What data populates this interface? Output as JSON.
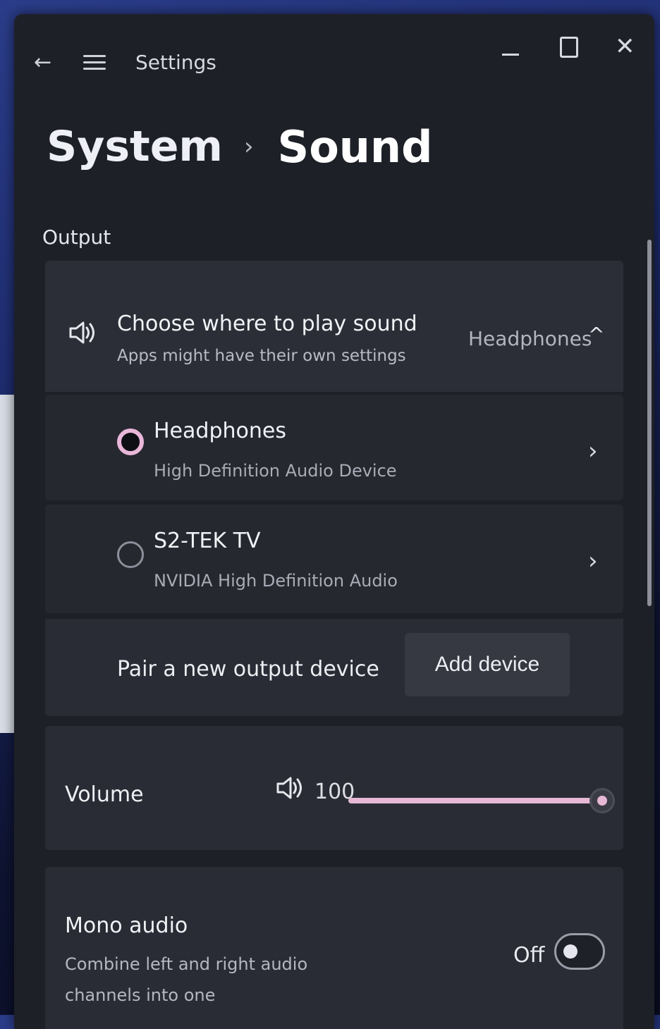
{
  "window": {
    "title": "Settings"
  },
  "breadcrumb": {
    "parent": "System",
    "separator": "›",
    "current": "Sound"
  },
  "output": {
    "section_label": "Output",
    "expander": {
      "title": "Choose where to play sound",
      "subtitle": "Apps might have their own settings",
      "selected_value": "Headphones",
      "chevron": "^",
      "icon": "speaker-icon"
    },
    "devices": [
      {
        "name": "Headphones",
        "description": "High Definition Audio Device",
        "selected": true
      },
      {
        "name": "S2-TEK TV",
        "description": "NVIDIA High Definition Audio",
        "selected": false
      }
    ],
    "pair": {
      "label": "Pair a new output device",
      "button_label": "Add device"
    }
  },
  "volume": {
    "label": "Volume",
    "value_text": "100",
    "level_percent": 100,
    "icon": "speaker-icon"
  },
  "mono_audio": {
    "title": "Mono audio",
    "description": "Combine left and right audio channels into one",
    "state_label": "Off",
    "enabled": false
  },
  "colors": {
    "accent": "#e6b8d6",
    "window_bg": "#1e2028",
    "card_bg": "#2a2c35"
  }
}
